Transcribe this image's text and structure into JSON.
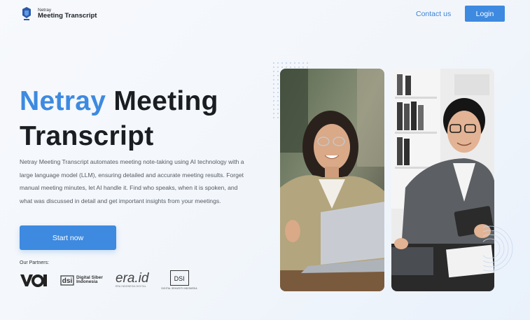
{
  "header": {
    "brand_small": "Netray",
    "brand_name": "Meeting Transcript",
    "contact_label": "Contact us",
    "login_label": "Login"
  },
  "hero": {
    "title_accent": "Netray",
    "title_rest_1": "Meeting",
    "title_rest_2": "Transcript",
    "description": "Netray Meeting Transcript automates meeting note-taking using AI technology with a large language model (LLM), ensuring detailed and accurate meeting results. Forget manual meeting minutes, let AI handle it. Find who speaks, when it is spoken, and what was discussed in detail and get important insights from your meetings.",
    "cta_label": "Start now"
  },
  "partners": {
    "label": "Our Partners:",
    "items": [
      {
        "name": "VOI"
      },
      {
        "name": "Digital Siber Indonesia",
        "line1": "Digital Siber",
        "line2": "Indonesia"
      },
      {
        "name": "era.id",
        "sub": "ERA INDONESIA DIGITAL"
      },
      {
        "name": "DSI",
        "sub": "DIGITAL SEKURITI INDONESIA"
      }
    ]
  },
  "images": {
    "left": "woman-with-laptop-photo",
    "right": "man-with-tablet-photo"
  },
  "colors": {
    "accent": "#3d8ae0",
    "title": "#1a1d21"
  }
}
